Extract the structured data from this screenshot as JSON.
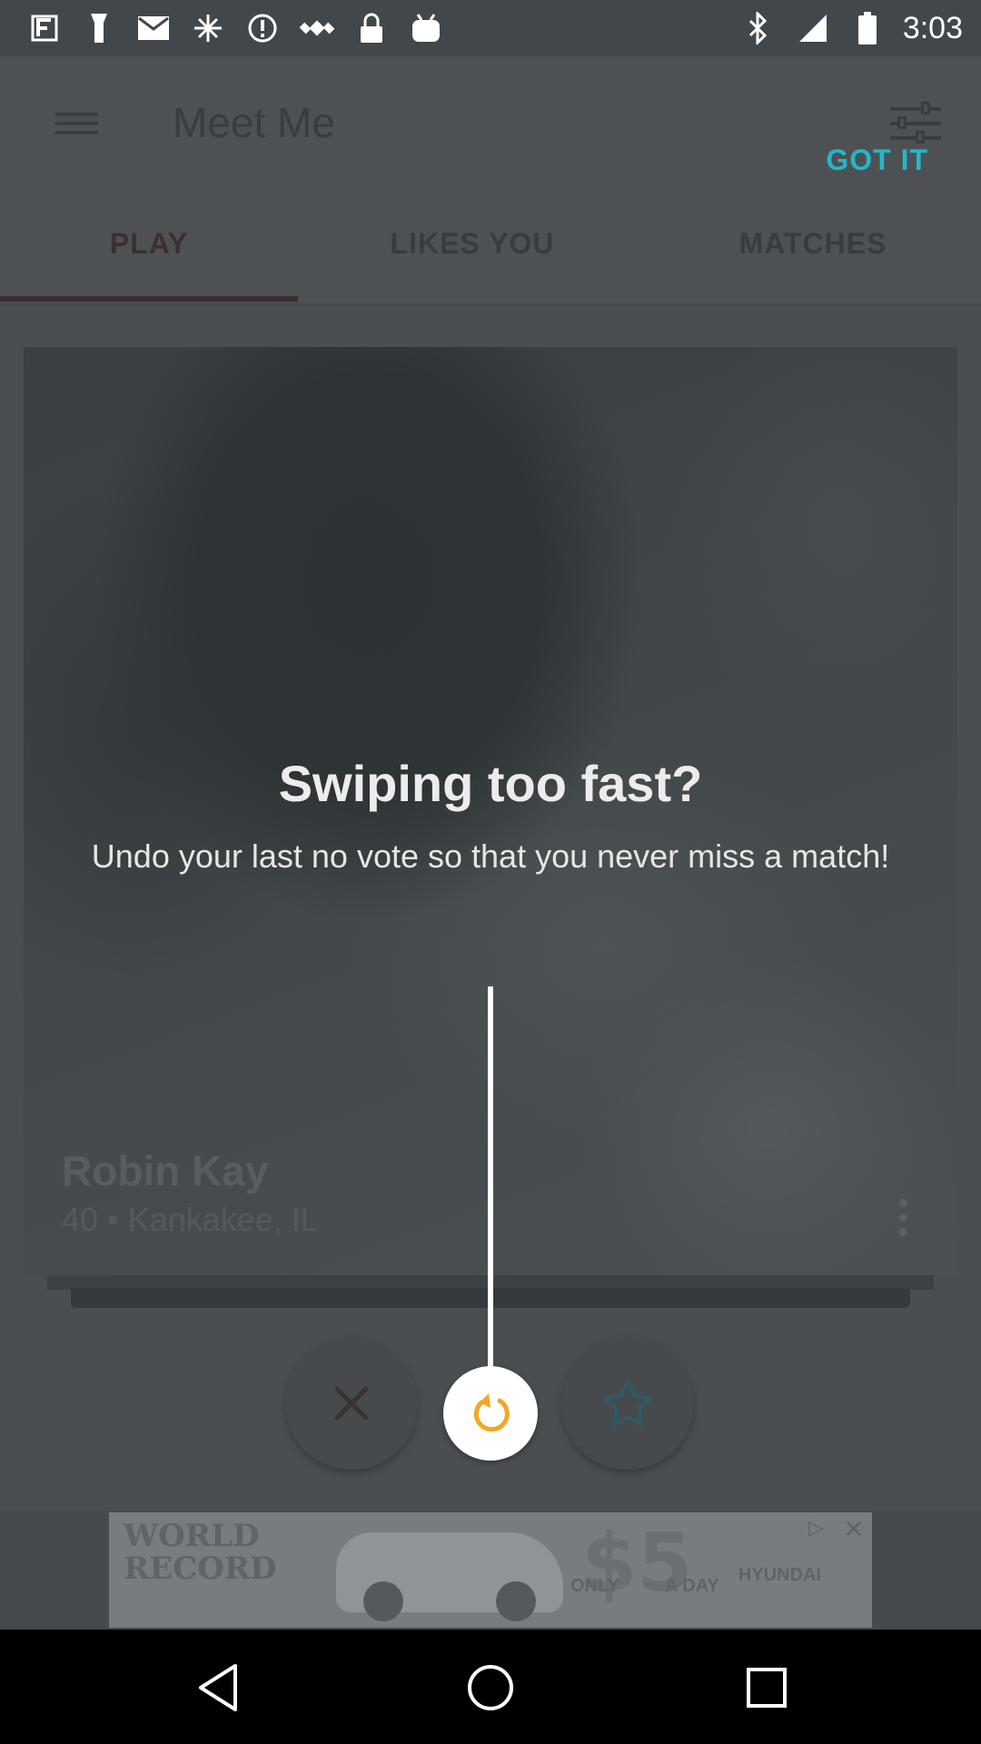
{
  "status_bar": {
    "time": "3:03",
    "icons": [
      "fake-gps-icon",
      "flashlight-icon",
      "gmail-icon",
      "network-icon",
      "info-icon",
      "satellite-icon",
      "lock-icon",
      "android-icon",
      "bluetooth-icon",
      "signal-icon",
      "battery-icon"
    ]
  },
  "header": {
    "title": "Meet Me",
    "got_it_label": "GOT IT",
    "accent_color": "#21b8c8"
  },
  "tabs": [
    {
      "label": "PLAY",
      "selected": true
    },
    {
      "label": "LIKES YOU",
      "selected": false
    },
    {
      "label": "MATCHES",
      "selected": false
    }
  ],
  "profile": {
    "name": "Robin Kay",
    "meta": "40 • Kankakee, IL"
  },
  "coach": {
    "title": "Swiping too fast?",
    "body": "Undo your last no vote so that you never miss a match!"
  },
  "actions": {
    "no_icon": "close-icon",
    "undo_icon": "undo-icon",
    "undo_color": "#f5a623",
    "favorite_icon": "star-icon"
  },
  "ad": {
    "line1": "WORLD",
    "line2": "RECORD",
    "price": "$5",
    "only": "ONLY",
    "day": "A DAY",
    "brand": "HYUNDAI"
  },
  "nav": {
    "back_icon": "back-icon",
    "home_icon": "home-icon",
    "recents_icon": "recents-icon"
  }
}
